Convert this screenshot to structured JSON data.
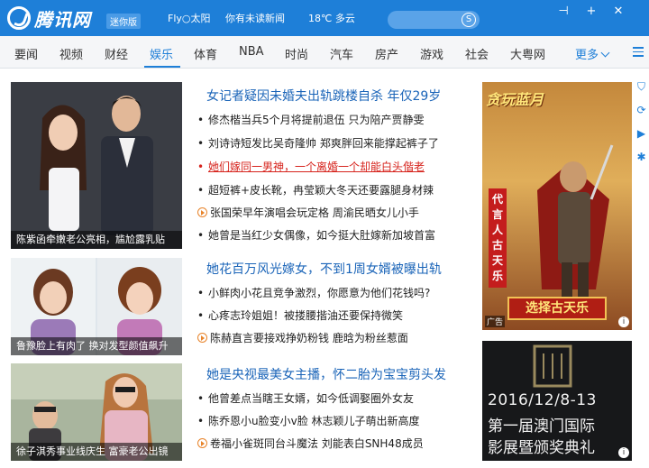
{
  "header": {
    "logo_text": "腾讯网",
    "mini_badge": "迷你版",
    "user_text": "Fly○太阳",
    "news_text": "你有未读新闻",
    "weather": "18℃ 多云",
    "search_placeholder": "",
    "pin_label": "⊣",
    "add_label": "+",
    "close_label": "✕"
  },
  "nav": {
    "items": [
      "要闻",
      "视频",
      "财经",
      "娱乐",
      "体育",
      "NBA",
      "时尚",
      "汽车",
      "房产",
      "游戏",
      "社会",
      "大粤网"
    ],
    "active": "娱乐",
    "more": "更多"
  },
  "tiles": {
    "tile1_caption": "陈紫函牵嫩老公亮相，尴尬露乳贴",
    "tile2_caption": "鲁豫脸上有肉了  换对发型颜值飙升",
    "tile3_caption": "徐子淇秀事业线庆生  富豪老公出镜"
  },
  "block1": {
    "headline": "女记者疑因未婚夫出轨跳楼自杀 年仅29岁",
    "rows": [
      "修杰楷当兵5个月将提前退伍  只为陪产贾静雯",
      "刘诗诗短发比吴奇隆帅  郑爽胖回来能撑起裤子了",
      "她们嫁同一男神，一个离婚一个却能白头偕老",
      "超短裤+皮长靴，冉莹颖大冬天还要露腿身材辣",
      "张国荣早年演唱会玩定格  周渝民晒女儿小手",
      "她曾是当红少女偶像，如今挺大肚嫁新加坡首富"
    ]
  },
  "block2": {
    "headline": "她花百万风光嫁女，不到1周女婿被曝出轨",
    "rows": [
      "小鲜肉小花且竞争激烈，你愿意为他们花钱吗?",
      "心疼志玲姐姐！被搂腰揩油还要保持微笑",
      "陈赫直言要接戏挣奶粉钱  鹿晗为粉丝惹面"
    ]
  },
  "block3": {
    "headline": "她是央视最美女主播，怀二胎为宝宝剪头发",
    "rows": [
      "他曾差点当瞎王女婿，如今低调娶圈外女友",
      "陈乔恩小u脸变小v脸  林志颖儿子萌出新高度",
      "卷福小雀斑同台斗魔法  刘能表白SNH48成员"
    ]
  },
  "ad1": {
    "title": "贪玩蓝月",
    "vertical_text": "代言人古天乐",
    "cta": "选择古天乐",
    "mark": "广告",
    "info": "i"
  },
  "ad2": {
    "date": "2016/12/8-13",
    "line2": "第一届澳门国际",
    "line3": "影展暨颁奖典礼",
    "info": "i"
  },
  "colors": {
    "brand": "#1e7fd8",
    "headline": "#1a64b8",
    "red_link": "#d6231c"
  }
}
